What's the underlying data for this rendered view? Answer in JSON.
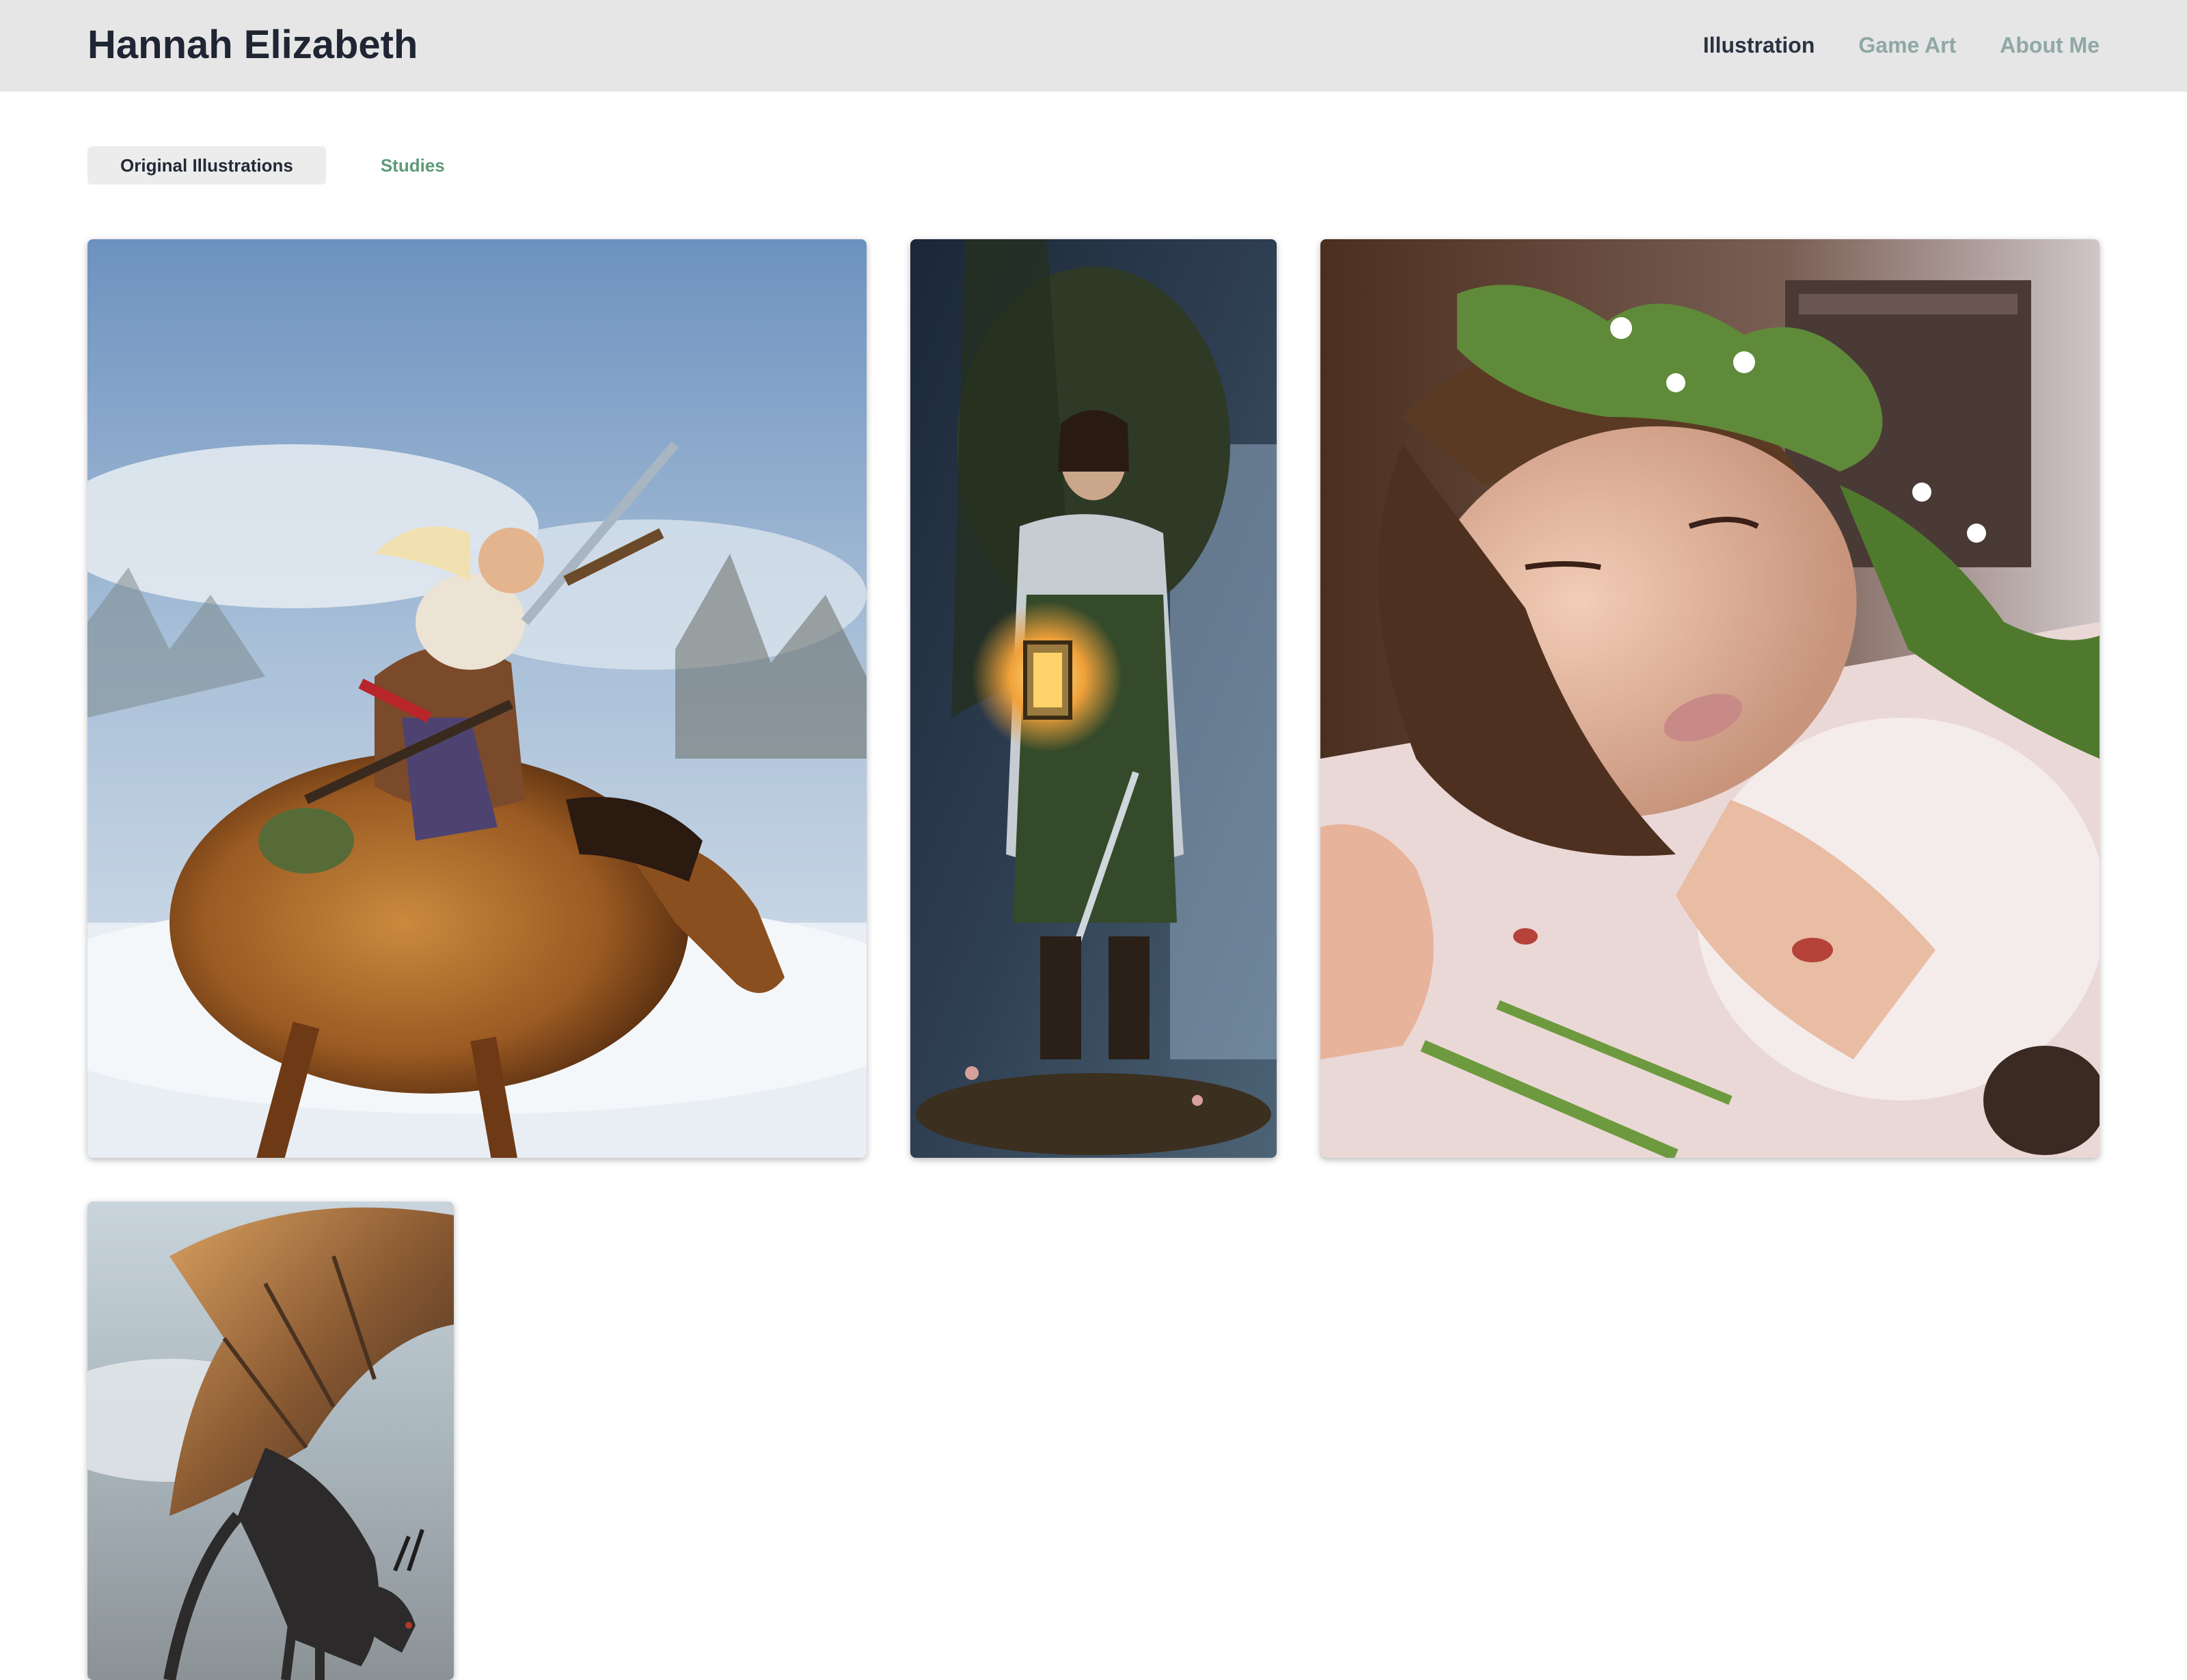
{
  "site": {
    "title": "Hannah Elizabeth"
  },
  "nav": {
    "items": [
      {
        "label": "Illustration",
        "active": true
      },
      {
        "label": "Game Art",
        "active": false
      },
      {
        "label": "About Me",
        "active": false
      }
    ]
  },
  "tabs": [
    {
      "label": "Original Illustrations",
      "active": true
    },
    {
      "label": "Studies",
      "active": false
    }
  ],
  "colors": {
    "header_bg": "#e6e6e6",
    "title": "#1f2533",
    "nav_active": "#2a3342",
    "nav_inactive": "#8fa8a5",
    "tab_inactive": "#5f9a78"
  }
}
